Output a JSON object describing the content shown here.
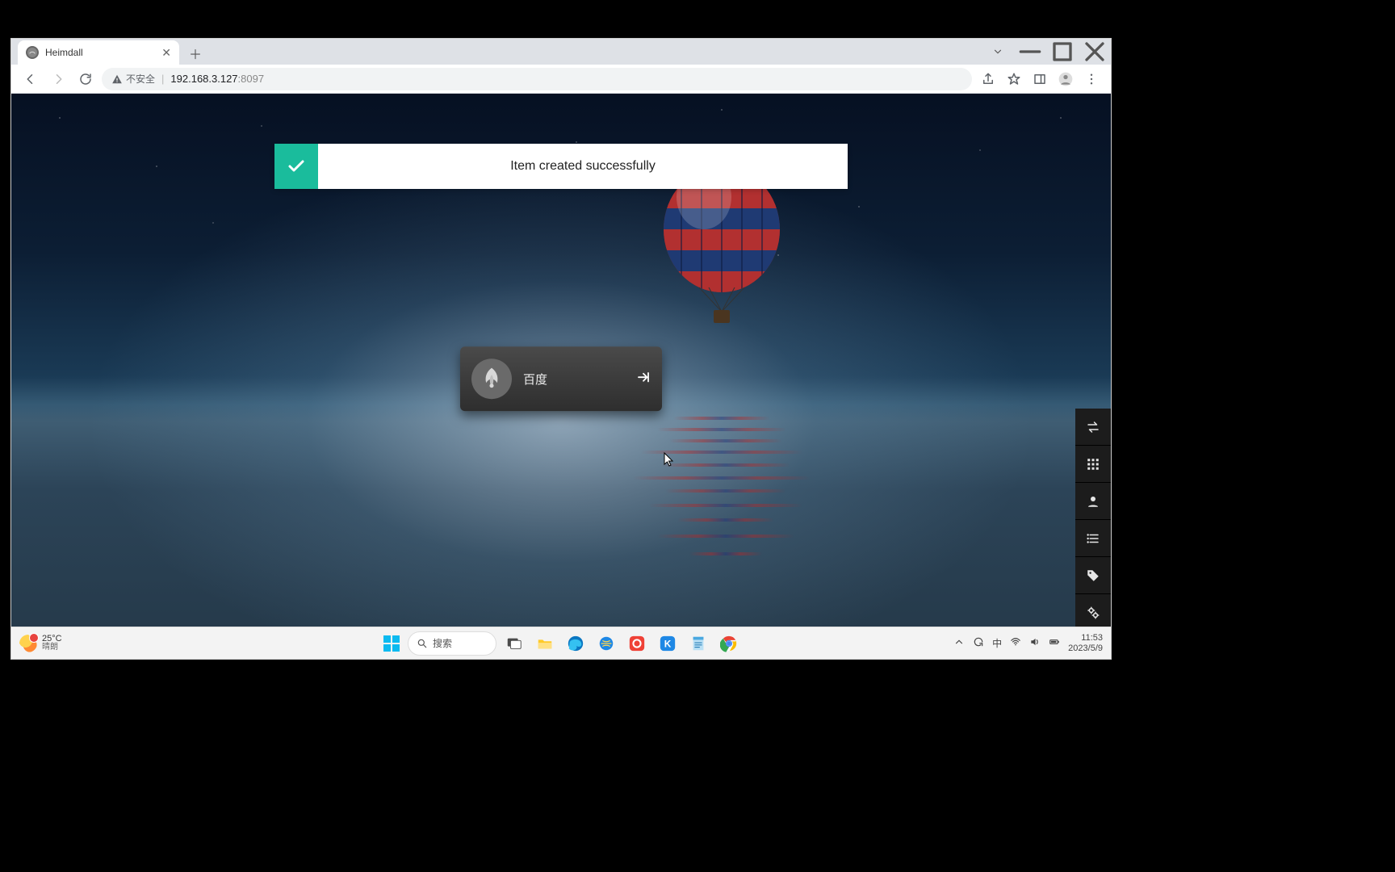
{
  "browser": {
    "tab_title": "Heimdall",
    "address_insecure_label": "不安全",
    "address_host": "192.168.3.127",
    "address_port": ":8097"
  },
  "page": {
    "toast_message": "Item created successfully",
    "tile_label": "百度"
  },
  "taskbar": {
    "weather_temp": "25°C",
    "weather_desc": "晴朗",
    "search_placeholder": "搜索",
    "ime": "中",
    "time": "11:53",
    "date": "2023/5/9"
  }
}
